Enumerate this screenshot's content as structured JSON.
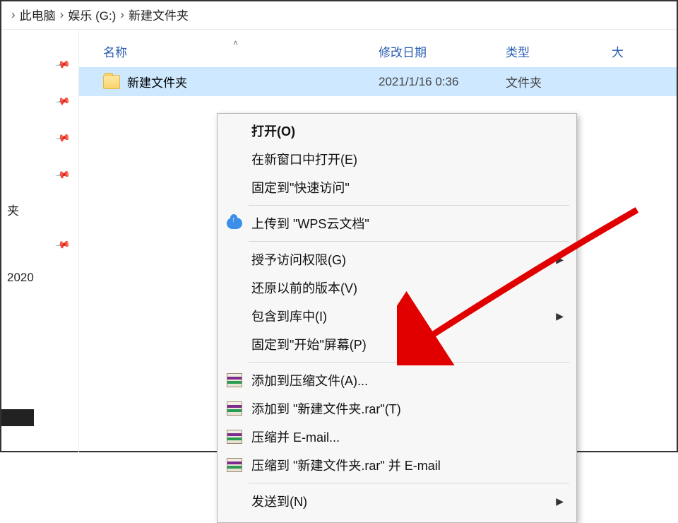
{
  "breadcrumb": {
    "items": [
      "此电脑",
      "娱乐 (G:)",
      "新建文件夹"
    ]
  },
  "sidebar": {
    "label_folder": "夹",
    "label_year": "2020"
  },
  "columns": {
    "name": "名称",
    "date": "修改日期",
    "type": "类型",
    "size": "大"
  },
  "row": {
    "name": "新建文件夹",
    "date": "2021/1/16 0:36",
    "type": "文件夹"
  },
  "contextmenu": {
    "open": "打开(O)",
    "open_new": "在新窗口中打开(E)",
    "pin_quick": "固定到\"快速访问\"",
    "upload_wps": "上传到 \"WPS云文档\"",
    "grant": "授予访问权限(G)",
    "restore": "还原以前的版本(V)",
    "include": "包含到库中(I)",
    "pin_start": "固定到\"开始\"屏幕(P)",
    "add_archive": "添加到压缩文件(A)...",
    "add_named": "添加到 \"新建文件夹.rar\"(T)",
    "zip_email": "压缩并 E-mail...",
    "zip_named_email": "压缩到 \"新建文件夹.rar\" 并 E-mail",
    "sendto": "发送到(N)"
  }
}
